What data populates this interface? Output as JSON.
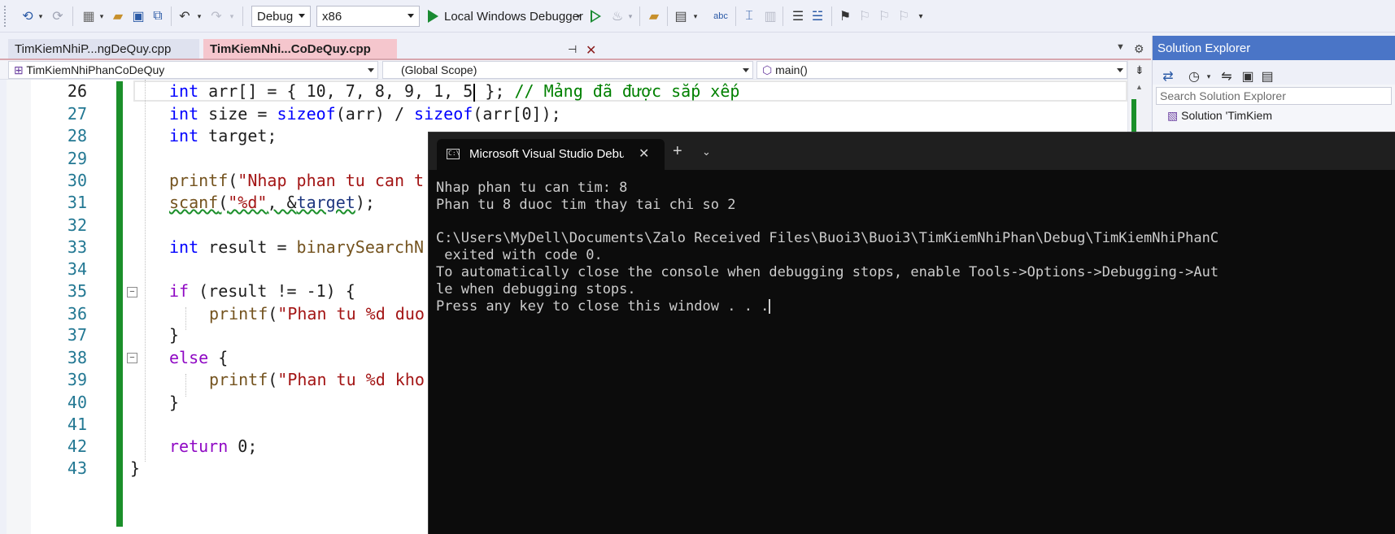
{
  "toolbar": {
    "config_value": "Debug",
    "platform_value": "x86",
    "debugger_label": "Local Windows Debugger"
  },
  "tabs": [
    {
      "label": "TimKiemNhiP...ngDeQuy.cpp",
      "active": false
    },
    {
      "label": "TimKiemNhi...CoDeQuy.cpp",
      "active": true
    }
  ],
  "navbar": {
    "project": "TimKiemNhiPhanCoDeQuy",
    "scope": "(Global Scope)",
    "member": "main()"
  },
  "editor": {
    "current_line": 26,
    "line_numbers": [
      "26",
      "27",
      "28",
      "29",
      "30",
      "31",
      "32",
      "33",
      "34",
      "35",
      "36",
      "37",
      "38",
      "39",
      "40",
      "41",
      "42",
      "43"
    ],
    "lines": {
      "l26": {
        "a": "int",
        "b": " arr[] = { 10, 7, 8, 9, 1, 5",
        "c": " }; ",
        "d": "// Mảng đã được sắp xếp"
      },
      "l27": {
        "a": "int",
        "b": " size = ",
        "c": "sizeof",
        "d": "(arr) / ",
        "e": "sizeof",
        "f": "(arr[0]);"
      },
      "l28": {
        "a": "int",
        "b": " target;"
      },
      "l30": {
        "a": "printf",
        "b": "(",
        "c": "\"Nhap phan tu can t"
      },
      "l31": {
        "a": "scanf",
        "b": "(",
        "c": "\"%d\"",
        "d": ", &",
        "e": "target",
        "f": ");"
      },
      "l33": {
        "a": "int",
        "b": " result = ",
        "c": "binarySearchN"
      },
      "l35": {
        "a": "if",
        "b": " (result != -1) {"
      },
      "l36": {
        "a": "printf",
        "b": "(",
        "c": "\"Phan tu %d duo"
      },
      "l37": {
        "a": "}"
      },
      "l38": {
        "a": "else",
        "b": " {"
      },
      "l39": {
        "a": "printf",
        "b": "(",
        "c": "\"Phan tu %d kho"
      },
      "l40": {
        "a": "}"
      },
      "l42": {
        "a": "return",
        "b": " 0;"
      },
      "l43": {
        "a": "}"
      }
    }
  },
  "solution_explorer": {
    "title": "Solution Explorer",
    "search_placeholder": "Search Solution Explorer",
    "solution_label": "Solution 'TimKiem"
  },
  "console": {
    "tab_title": "Microsoft Visual Studio Debug",
    "lines": [
      "Nhap phan tu can tim: 8",
      "Phan tu 8 duoc tim thay tai chi so 2",
      "",
      "C:\\Users\\MyDell\\Documents\\Zalo Received Files\\Buoi3\\Buoi3\\TimKiemNhiPhan\\Debug\\TimKiemNhiPhanC",
      " exited with code 0.",
      "To automatically close the console when debugging stops, enable Tools->Options->Debugging->Aut",
      "le when debugging stops.",
      "Press any key to close this window . . ."
    ]
  },
  "colors": {
    "keyword": "#0000ff",
    "function": "#74531f",
    "string": "#a31515",
    "comment": "#008000",
    "control": "#8f08c4",
    "line_number": "#237893",
    "change_bar": "#1b8f2a",
    "active_tab": "#f5c6cd",
    "console_bg": "#0c0c0c"
  },
  "icons": [
    "back-icon",
    "forward-icon",
    "new-project-icon",
    "open-folder-icon",
    "save-icon",
    "save-all-icon",
    "undo-icon",
    "redo-icon",
    "start-debug-icon",
    "start-without-debug-icon",
    "hot-reload-icon",
    "folder-icon",
    "layout-icon",
    "spell-check-icon",
    "bookmark-icon",
    "pin-icon",
    "close-icon",
    "settings-icon",
    "terminal-icon",
    "plus-icon",
    "chevron-down-icon"
  ]
}
